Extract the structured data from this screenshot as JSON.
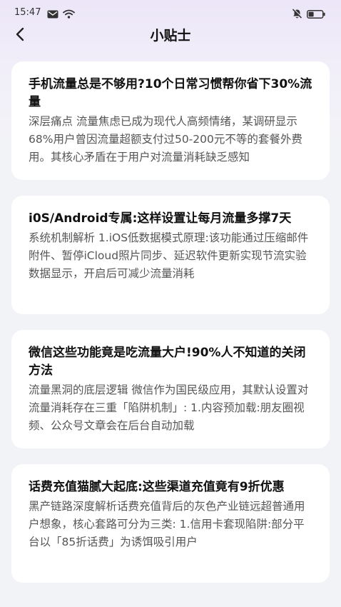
{
  "status_bar": {
    "time": "15:47",
    "left_icons": [
      "message-icon",
      "wifi-icon"
    ],
    "right_icons": [
      "notification-off-icon",
      "battery-icon"
    ]
  },
  "header": {
    "title": "小贴士",
    "back_icon": "chevron-left-icon"
  },
  "tips": [
    {
      "title": "手机流量总是不够用?10个日常习惯帮你省下30%流量",
      "body": "深层痛点 流量焦虑已成为现代人高频情绪，某调研显示68%用户曾因流量超额支付过50-200元不等的套餐外费用。其核心矛盾在于用户对流量消耗缺乏感知"
    },
    {
      "title": "i0S/Android专属:这样设置让每月流量多撑7天",
      "body": "系统机制解析 1.iOS低数据模式原理:该功能通过压缩邮件附件、暂停iCloud照片同步、延迟软件更新实现节流实验数据显示，开启后可减少流量消耗"
    },
    {
      "title": "微信这些功能竟是吃流量大户!90%人不知道的关闭方法",
      "body": "流量黑洞的底层逻辑 微信作为国民级应用，其默认设置对流量消耗存在三重「陷阱机制」: 1.内容预加载:朋友圈视频、公众号文章会在后台自动加载"
    },
    {
      "title": "话费充值猫腻大起底:这些渠道充值竟有9折优惠",
      "body": "黑产链路深度解析话费充值背后的灰色产业链远超普通用户想象，核心套路可分为三类: 1.信用卡套现陷阱:部分平台以「85折话费」为诱饵吸引用户"
    }
  ]
}
